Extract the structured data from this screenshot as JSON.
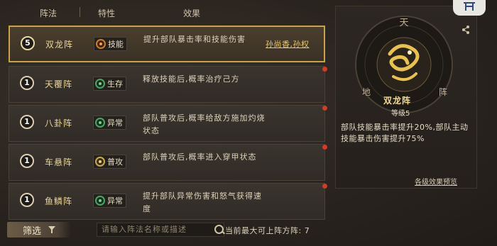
{
  "header": {
    "col_formation": "阵法",
    "col_trait": "特性",
    "col_effect": "效果"
  },
  "rows": [
    {
      "level": "5",
      "name": "双龙阵",
      "trait": "技能",
      "trait_color": "orange",
      "desc": "提升部队暴击率和技能伤害",
      "members": "孙尚香,孙权",
      "selected": true,
      "dot": false
    },
    {
      "level": "1",
      "name": "天覆阵",
      "trait": "生存",
      "trait_color": "green",
      "desc": "释放技能后,概率治疗己方",
      "members": "",
      "selected": false,
      "dot": true
    },
    {
      "level": "1",
      "name": "八卦阵",
      "trait": "异常",
      "trait_color": "green",
      "desc": "部队普攻后,概率给敌方施加灼烧状态",
      "members": "",
      "selected": false,
      "dot": true
    },
    {
      "level": "1",
      "name": "车悬阵",
      "trait": "普攻",
      "trait_color": "yellow",
      "desc": "部队普攻后,概率进入穿甲状态",
      "members": "",
      "selected": false,
      "dot": true
    },
    {
      "level": "1",
      "name": "鱼鳞阵",
      "trait": "异常",
      "trait_color": "green",
      "desc": "提升部队异常伤害和怒气获得速度",
      "members": "",
      "selected": false,
      "dot": true
    }
  ],
  "footer": {
    "filter_label": "筛选",
    "search_placeholder": "请输入阵法名称或描述",
    "limit_text": "当前最大可上阵方阵: 7"
  },
  "detail": {
    "name": "双龙阵",
    "level": "等级5",
    "desc": "部队技能暴击率提升20%,部队主动技能暴击伤害提升75%",
    "preview_link": "各级效果预览",
    "ring_glyphs": [
      "天",
      "地",
      "阵"
    ]
  },
  "colors": {
    "accent_gold": "#c9a24a",
    "dot_red": "#d23a2a"
  }
}
